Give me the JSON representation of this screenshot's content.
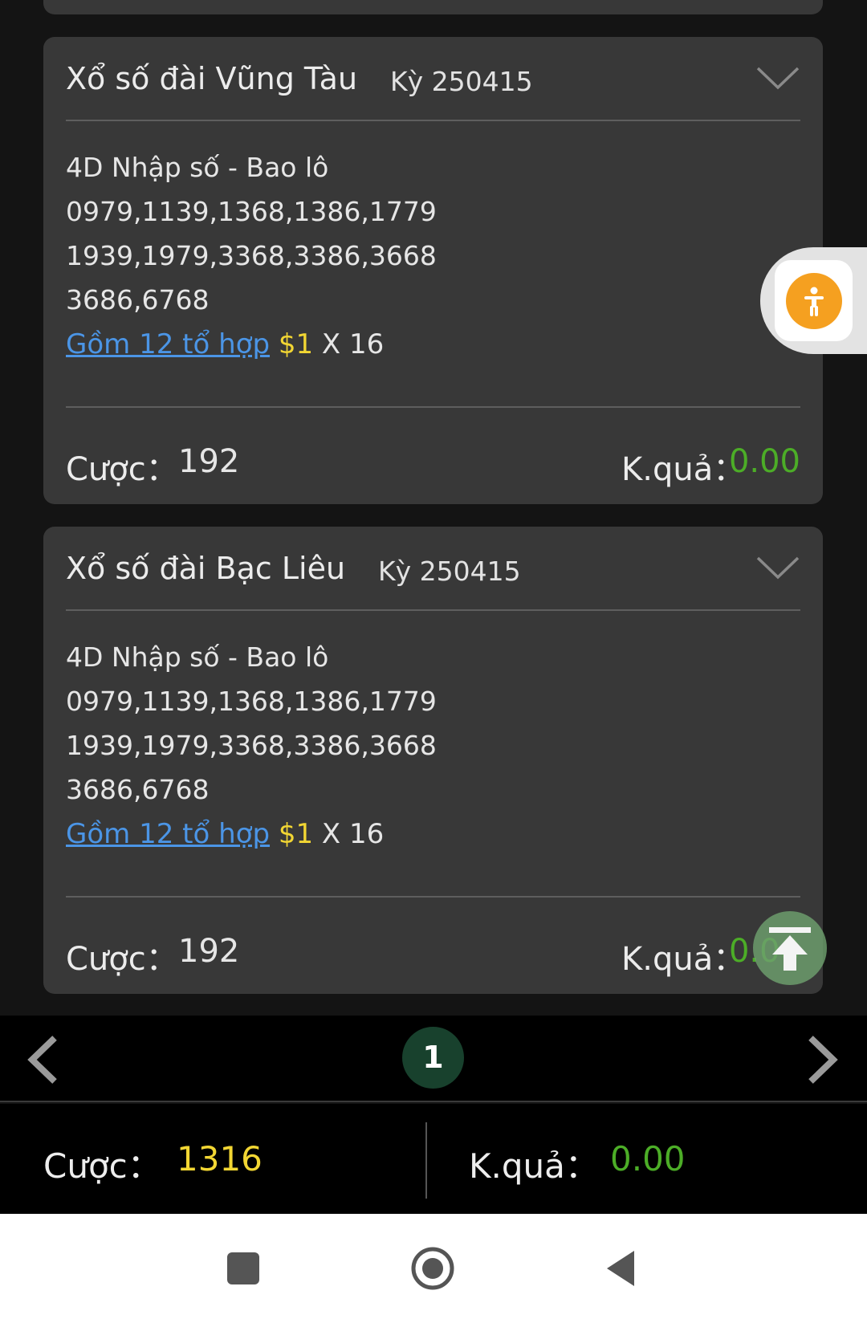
{
  "cards": [
    {
      "title": "Xổ số đài Vũng Tàu",
      "period": "Kỳ 250415",
      "bet_type": "4D Nhập số - Bao lô",
      "numbers": [
        "0979,1139,1368,1386,1779",
        "1939,1979,3368,3386,3668",
        "3686,6768"
      ],
      "combo_link": "Gồm 12 tổ hợp",
      "combo_price": "$1",
      "combo_mult": "X 16",
      "bet_label": "Cược：",
      "bet_value": "192",
      "result_label": "K.quả：",
      "result_value": "0.00"
    },
    {
      "title": "Xổ số đài Bạc Liêu",
      "period": "Kỳ 250415",
      "bet_type": "4D Nhập số - Bao lô",
      "numbers": [
        "0979,1139,1368,1386,1779",
        "1939,1979,3368,3386,3668",
        "3686,6768"
      ],
      "combo_link": "Gồm 12 tổ hợp",
      "combo_price": "$1",
      "combo_mult": "X 16",
      "bet_label": "Cược：",
      "bet_value": "192",
      "result_label": "K.quả：",
      "result_value": "0.00"
    }
  ],
  "pager": {
    "current_page": "1"
  },
  "summary": {
    "bet_label": "Cược：",
    "bet_total": "1316",
    "result_label": "K.quả：",
    "result_total": "0.00"
  },
  "icons": {
    "chevron": "chevron-down-icon",
    "prev": "chevron-left-icon",
    "next": "chevron-right-icon",
    "accessibility": "accessibility-icon",
    "scroll_top": "arrow-up-to-top-icon",
    "nav_recent": "square-icon",
    "nav_home": "circle-icon",
    "nav_back": "triangle-back-icon"
  },
  "colors": {
    "accent_yellow": "#f2d633",
    "accent_green": "#4cad27",
    "link_blue": "#4b95e6",
    "page_badge": "#18412d",
    "fab_orange": "#f5a020"
  }
}
